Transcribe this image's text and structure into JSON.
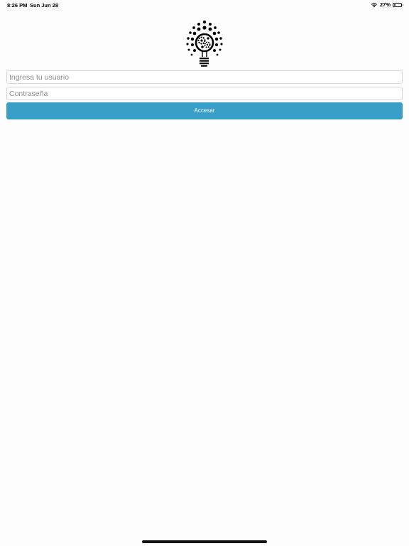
{
  "status_bar": {
    "time": "8:26 PM",
    "date": "Sun Jun 28",
    "battery_text": "27%",
    "battery_level": 0.27,
    "wifi_icon": "wifi-icon",
    "battery_icon": "battery-icon"
  },
  "logo": {
    "icon": "lightbulb-gears-logo"
  },
  "login": {
    "username_placeholder": "Ingresa tu usuario",
    "password_placeholder": "Contraseña",
    "submit_label": "Accesar",
    "accent_color": "#3a9fc8"
  }
}
